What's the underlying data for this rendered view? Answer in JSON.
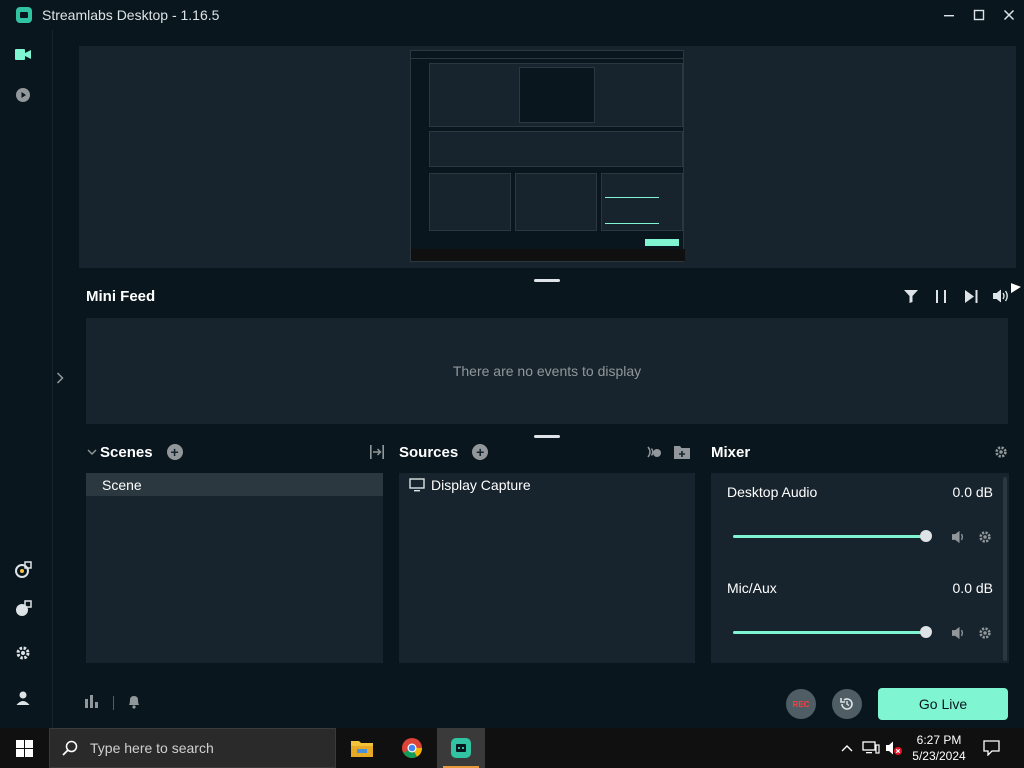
{
  "window": {
    "title": "Streamlabs Desktop - 1.16.5"
  },
  "mini_feed": {
    "title": "Mini Feed",
    "empty_message": "There are no events to display"
  },
  "scenes": {
    "title": "Scenes",
    "items": [
      {
        "label": "Scene"
      }
    ]
  },
  "sources": {
    "title": "Sources",
    "items": [
      {
        "label": "Display Capture"
      }
    ]
  },
  "mixer": {
    "title": "Mixer",
    "channels": [
      {
        "label": "Desktop Audio",
        "level": "0.0 dB",
        "volume_fraction": 1.0
      },
      {
        "label": "Mic/Aux",
        "level": "0.0 dB",
        "volume_fraction": 1.0
      }
    ]
  },
  "footer": {
    "rec_label": "REC",
    "go_live_label": "Go Live"
  },
  "taskbar": {
    "search_placeholder": "Type here to search",
    "time": "6:27 PM",
    "date": "5/23/2024"
  },
  "colors": {
    "background": "#09161d",
    "panel": "#17242d",
    "accent": "#80f5d2",
    "rec": "#fc3e3f"
  }
}
